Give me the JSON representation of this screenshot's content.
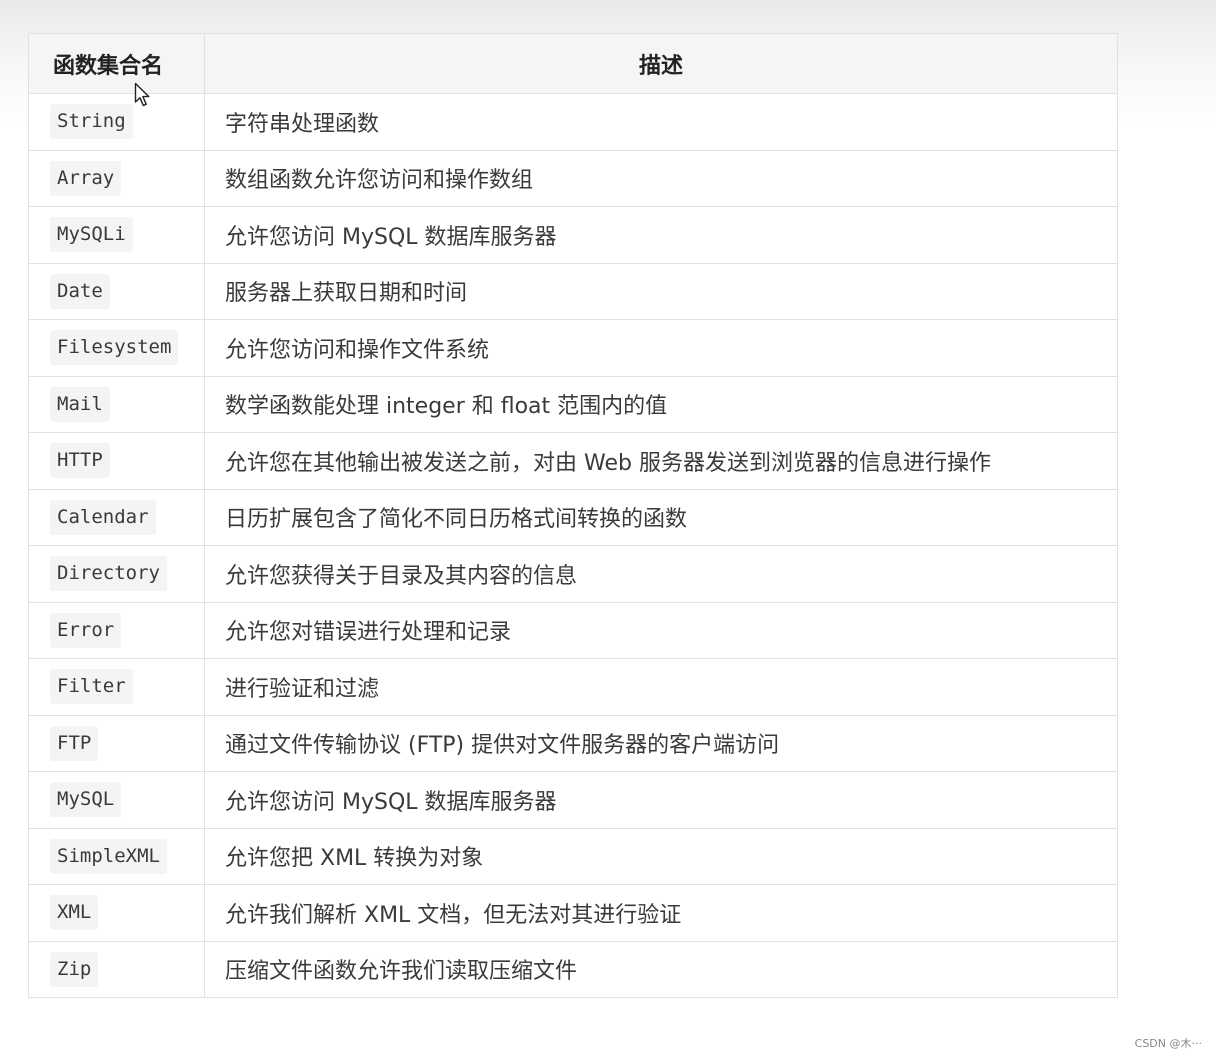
{
  "table": {
    "headers": {
      "name": "函数集合名",
      "description": "描述"
    },
    "rows": [
      {
        "name": "String",
        "description": "字符串处理函数"
      },
      {
        "name": "Array",
        "description": "数组函数允许您访问和操作数组"
      },
      {
        "name": "MySQLi",
        "description": "允许您访问 MySQL 数据库服务器"
      },
      {
        "name": "Date",
        "description": "服务器上获取日期和时间"
      },
      {
        "name": "Filesystem",
        "description": "允许您访问和操作文件系统"
      },
      {
        "name": "Mail",
        "description": "数学函数能处理 integer 和 float 范围内的值"
      },
      {
        "name": "HTTP",
        "description": "允许您在其他输出被发送之前，对由 Web 服务器发送到浏览器的信息进行操作"
      },
      {
        "name": "Calendar",
        "description": "日历扩展包含了简化不同日历格式间转换的函数"
      },
      {
        "name": "Directory",
        "description": "允许您获得关于目录及其内容的信息"
      },
      {
        "name": "Error",
        "description": "允许您对错误进行处理和记录"
      },
      {
        "name": "Filter",
        "description": "进行验证和过滤"
      },
      {
        "name": "FTP",
        "description": "通过文件传输协议 (FTP) 提供对文件服务器的客户端访问"
      },
      {
        "name": "MySQL",
        "description": "允许您访问 MySQL 数据库服务器"
      },
      {
        "name": "SimpleXML",
        "description": "允许您把 XML 转换为对象"
      },
      {
        "name": "XML",
        "description": "允许我们解析 XML 文档，但无法对其进行验证"
      },
      {
        "name": "Zip",
        "description": "压缩文件函数允许我们读取压缩文件"
      }
    ]
  },
  "watermark": "CSDN @木···",
  "icons": {
    "cursor": "mouse-pointer-icon"
  }
}
